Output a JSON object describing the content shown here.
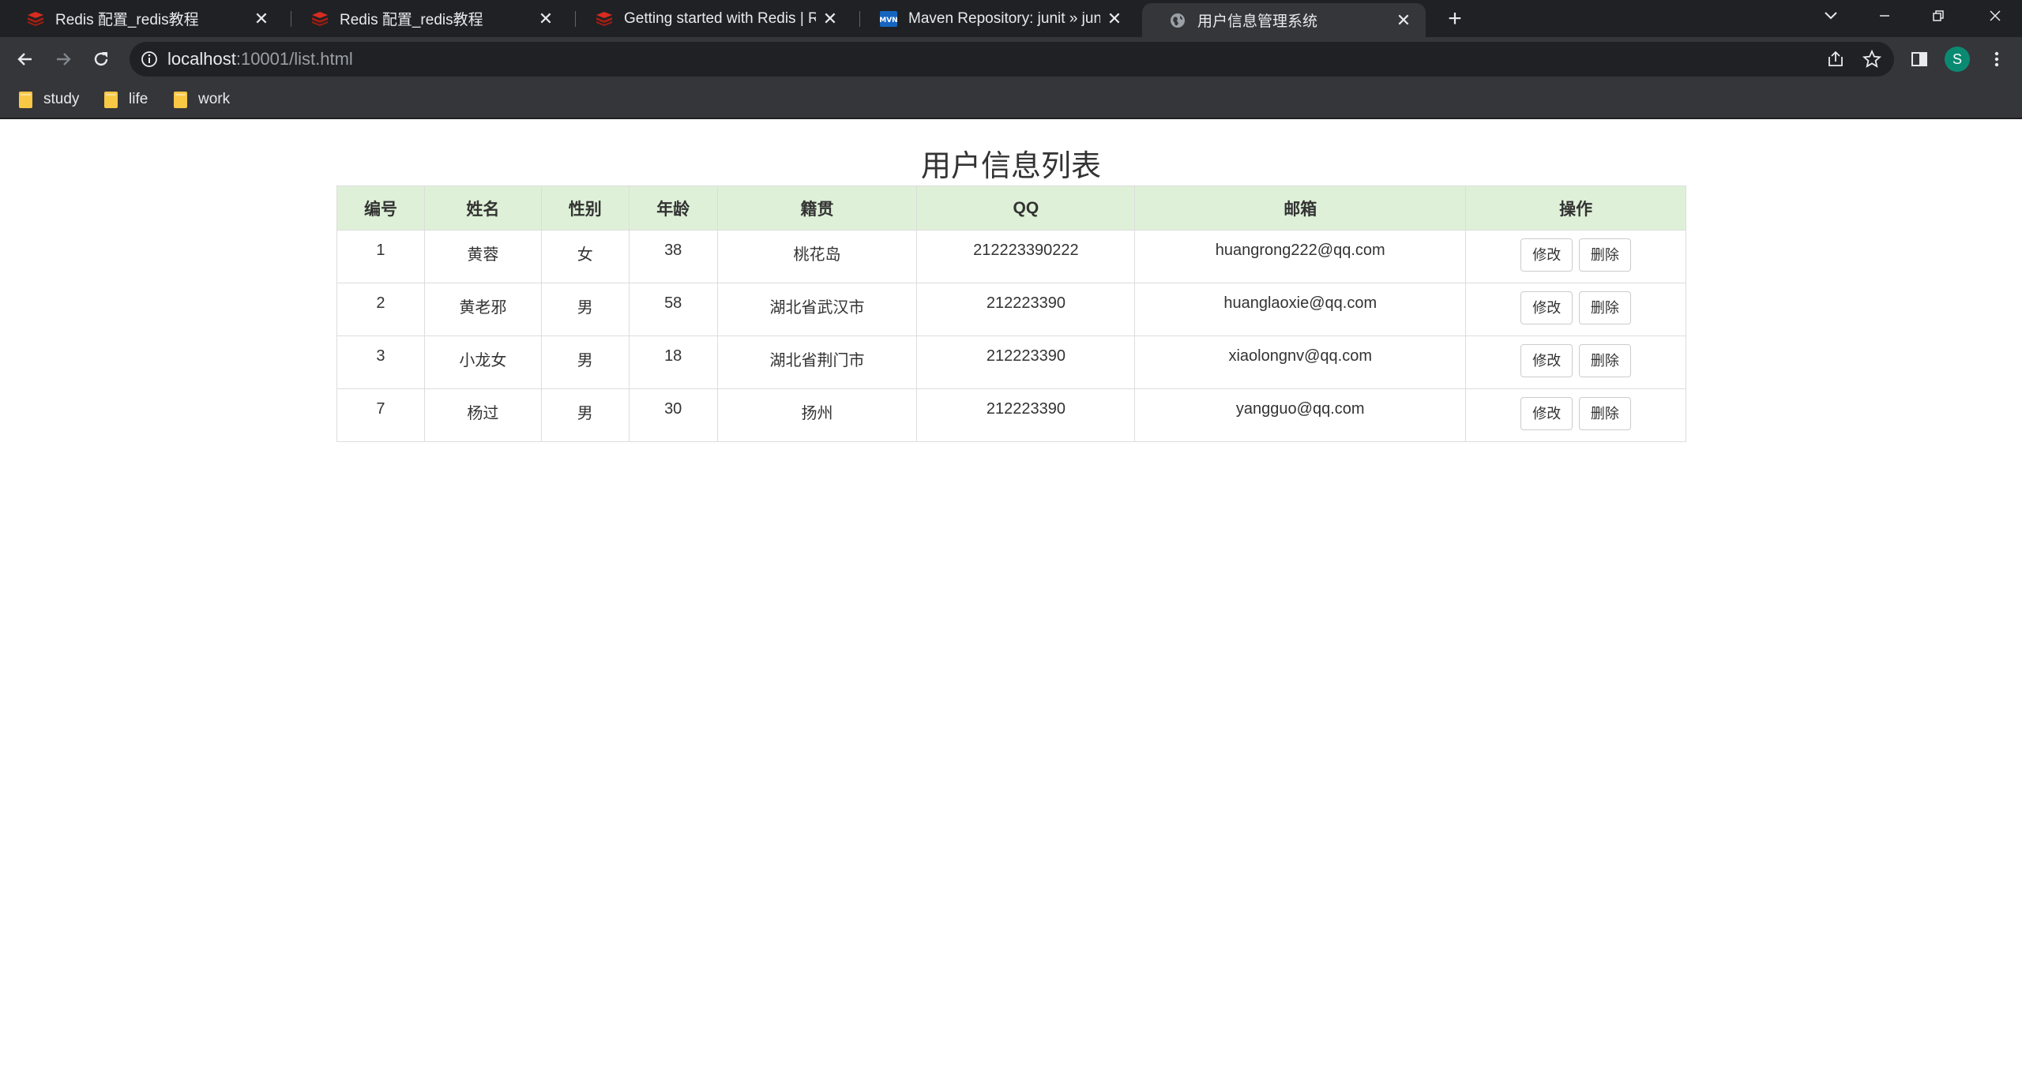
{
  "browser": {
    "tabs": [
      {
        "title": "Redis 配置_redis教程",
        "icon": "redis-icon",
        "active": false
      },
      {
        "title": "Redis 配置_redis教程",
        "icon": "redis-icon",
        "active": false
      },
      {
        "title": "Getting started with Redis | Re",
        "icon": "redis-icon",
        "active": false
      },
      {
        "title": "Maven Repository: junit » junit",
        "icon": "mvn-icon",
        "active": false
      },
      {
        "title": "用户信息管理系统",
        "icon": "globe-icon",
        "active": true
      }
    ],
    "address": {
      "host": "localhost",
      "rest": ":10001/list.html"
    },
    "profile_initial": "S",
    "bookmarks": [
      {
        "label": "study"
      },
      {
        "label": "life"
      },
      {
        "label": "work"
      }
    ],
    "colors": {
      "tabstrip": "#202124",
      "toolbar": "#35363a",
      "avatar": "#0b8a72",
      "folder": "#f9c845"
    }
  },
  "page": {
    "title": "用户信息列表",
    "table": {
      "headers": [
        "编号",
        "姓名",
        "性别",
        "年龄",
        "籍贯",
        "QQ",
        "邮箱",
        "操作"
      ],
      "header_bg": "#dff0d8",
      "rows": [
        {
          "id": "1",
          "name": "黄蓉",
          "gender": "女",
          "age": "38",
          "address": "桃花岛",
          "qq": "212223390222",
          "email": "huangrong222@qq.com"
        },
        {
          "id": "2",
          "name": "黄老邪",
          "gender": "男",
          "age": "58",
          "address": "湖北省武汉市",
          "qq": "212223390",
          "email": "huanglaoxie@qq.com"
        },
        {
          "id": "3",
          "name": "小龙女",
          "gender": "男",
          "age": "18",
          "address": "湖北省荆门市",
          "qq": "212223390",
          "email": "xiaolongnv@qq.com"
        },
        {
          "id": "7",
          "name": "杨过",
          "gender": "男",
          "age": "30",
          "address": "扬州",
          "qq": "212223390",
          "email": "yangguo@qq.com"
        }
      ],
      "edit_label": "修改",
      "delete_label": "删除"
    }
  }
}
